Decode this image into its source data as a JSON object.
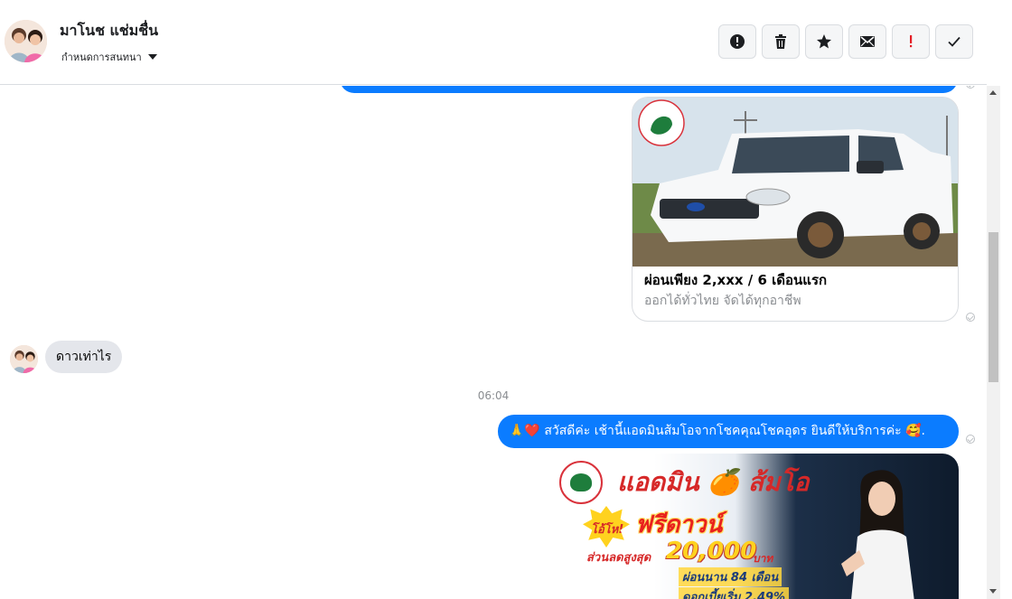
{
  "header": {
    "contact_name": "มาโนช แช่มชื่น",
    "conversation_menu_label": "กำหนดการสนทนา",
    "actions": [
      "report-icon",
      "trash-icon",
      "star-icon",
      "mail-icon",
      "exclamation-icon",
      "check-icon"
    ]
  },
  "messages": {
    "card": {
      "title": "ผ่อนเพียง 2,xxx / 6 เดือนแรก",
      "subtitle": "ออกได้ทั่วไทย จัดได้ทุกอาชีพ"
    },
    "incoming_text": "ดาวเท่าไร",
    "timestamp": "06:04",
    "outgoing_text": "🙏❤️ สวัสดีค่ะ เช้านี้แอดมินส้มโอจากโชคคุณโชคอุดร ยินดีให้บริการค่ะ 🥰.",
    "promo": {
      "headline": "แอดมิน 🍊 ส้มโอ",
      "badge": "โอ้โห!",
      "offer": "ฟรีดาวน์",
      "discount_label": "ส่วนลดสูงสุด",
      "discount_amount": "20,000",
      "currency": "บาท",
      "installment": "ผ่อนนาน 84 เดือน",
      "interest": "ดอกเบี้ยเริ่ม 2.49%"
    }
  },
  "colors": {
    "outgoing_bubble": "#0b7cff",
    "incoming_bubble": "#e4e6eb",
    "accent_red": "#e41e26"
  }
}
